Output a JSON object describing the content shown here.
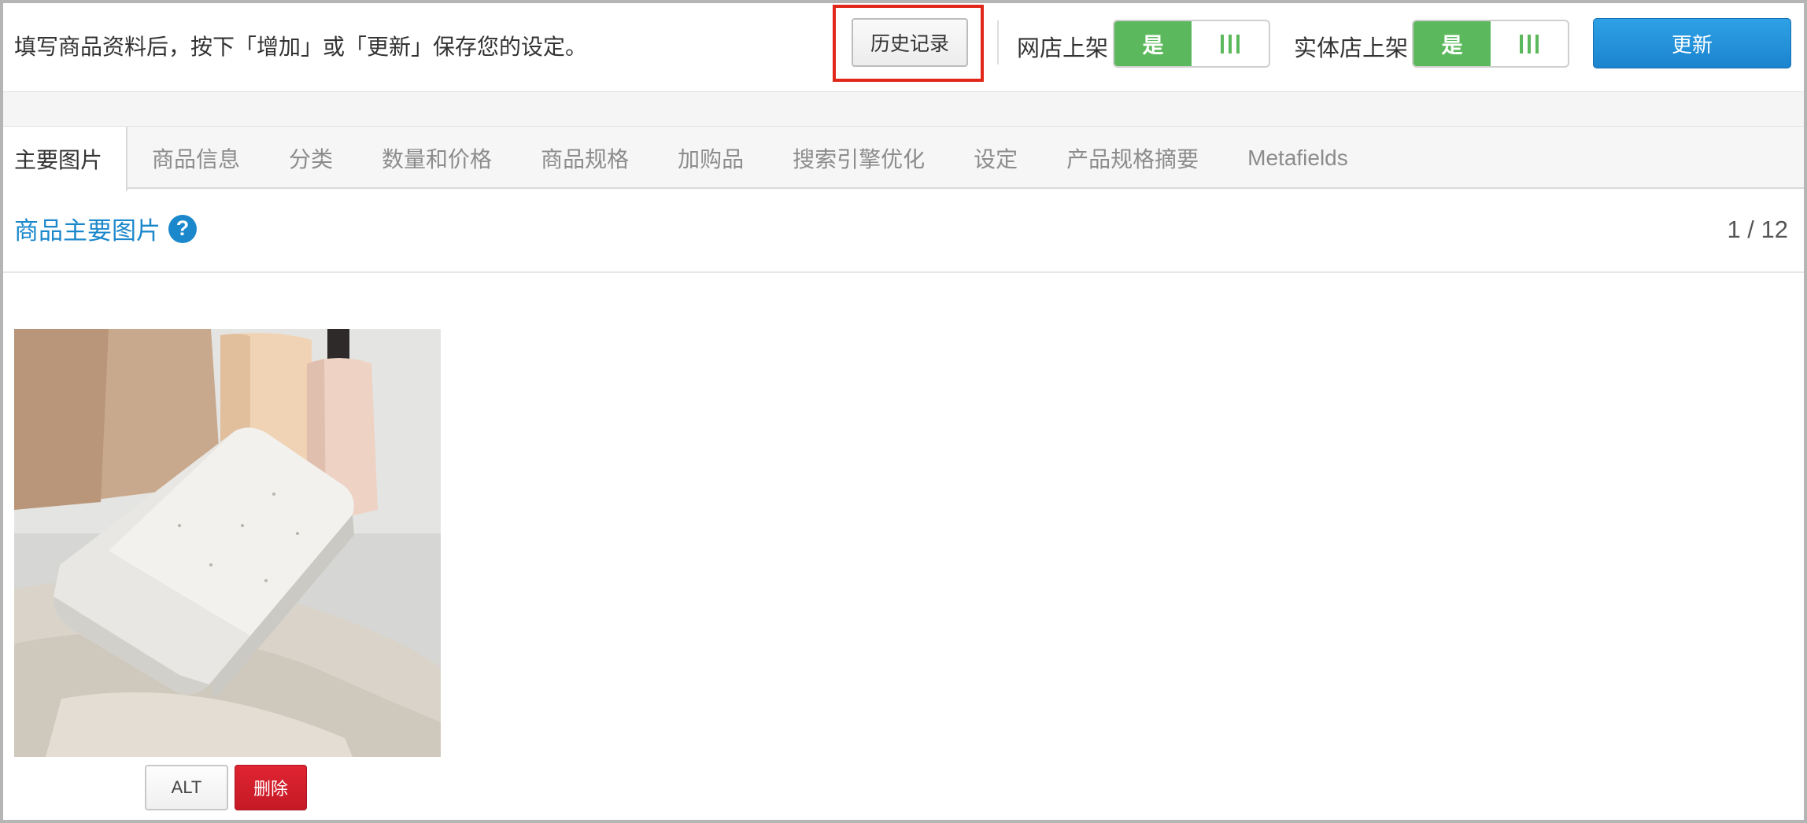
{
  "header": {
    "hint": "填写商品资料后，按下「增加」或「更新」保存您的设定。",
    "history_label": "历史记录",
    "online_store_label": "网店上架",
    "online_store_value": "是",
    "physical_store_label": "实体店上架",
    "physical_store_value": "是",
    "update_label": "更新"
  },
  "tabs": [
    {
      "label": "主要图片",
      "active": true
    },
    {
      "label": "商品信息"
    },
    {
      "label": "分类"
    },
    {
      "label": "数量和价格"
    },
    {
      "label": "商品规格"
    },
    {
      "label": "加购品"
    },
    {
      "label": "搜索引擎优化"
    },
    {
      "label": "设定"
    },
    {
      "label": "产品规格摘要"
    },
    {
      "label": "Metafields"
    }
  ],
  "section": {
    "title": "商品主要图片",
    "help_icon": "?",
    "page_count": "1 / 12"
  },
  "image_actions": {
    "alt_label": "ALT",
    "delete_label": "删除"
  },
  "colors": {
    "accent_blue": "#1c88cc",
    "toggle_green": "#5cb85c",
    "delete_red": "#d01f2b",
    "highlight_red": "#e0271a"
  }
}
